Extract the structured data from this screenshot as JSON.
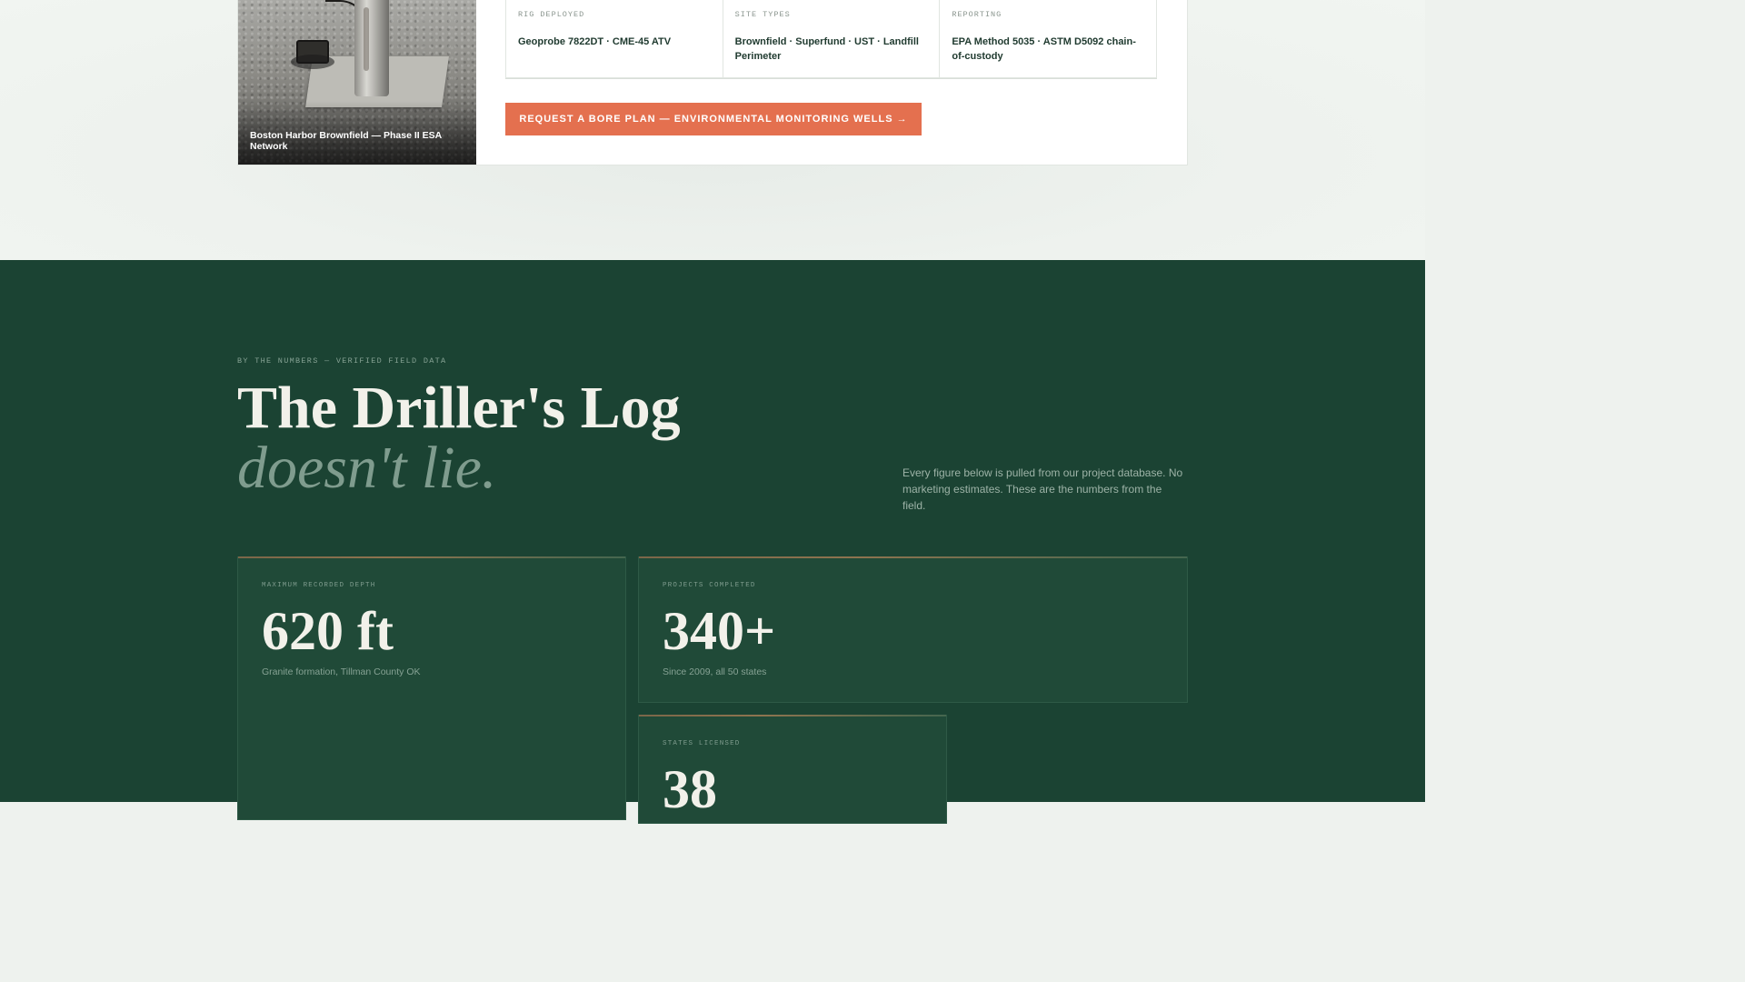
{
  "case_study": {
    "photo_caption": "Boston Harbor Brownfield — Phase II ESA Network",
    "specs": [
      {
        "label": "RIG DEPLOYED",
        "value": "Geoprobe 7822DT · CME-45 ATV"
      },
      {
        "label": "SITE TYPES",
        "value": "Brownfield · Superfund · UST · Landfill Perimeter"
      },
      {
        "label": "REPORTING",
        "value": "EPA Method 5035 · ASTM D5092 chain-of-custody"
      }
    ],
    "cta_label": "REQUEST A BORE PLAN — ENVIRONMENTAL MONITORING WELLS →"
  },
  "numbers_section": {
    "eyebrow": "BY THE NUMBERS — VERIFIED FIELD DATA",
    "headline": "The Driller's Log",
    "headline_italic": "doesn't lie.",
    "intro": "Every figure below is pulled from our project database. No marketing estimates. These are the numbers from the field.",
    "stats": [
      {
        "label": "MAXIMUM RECORDED DEPTH",
        "value": "620 ft",
        "note": "Granite formation, Tillman County OK"
      },
      {
        "label": "PROJECTS COMPLETED",
        "value": "340+",
        "note": "Since 2009, all 50 states"
      },
      {
        "label": "STATES LICENSED",
        "value": "38",
        "note": ""
      }
    ]
  },
  "colors": {
    "accent": "#e4704f",
    "dark_green": "#1b4333",
    "card_green": "#204a38",
    "heading_text": "#1f3a2f"
  }
}
